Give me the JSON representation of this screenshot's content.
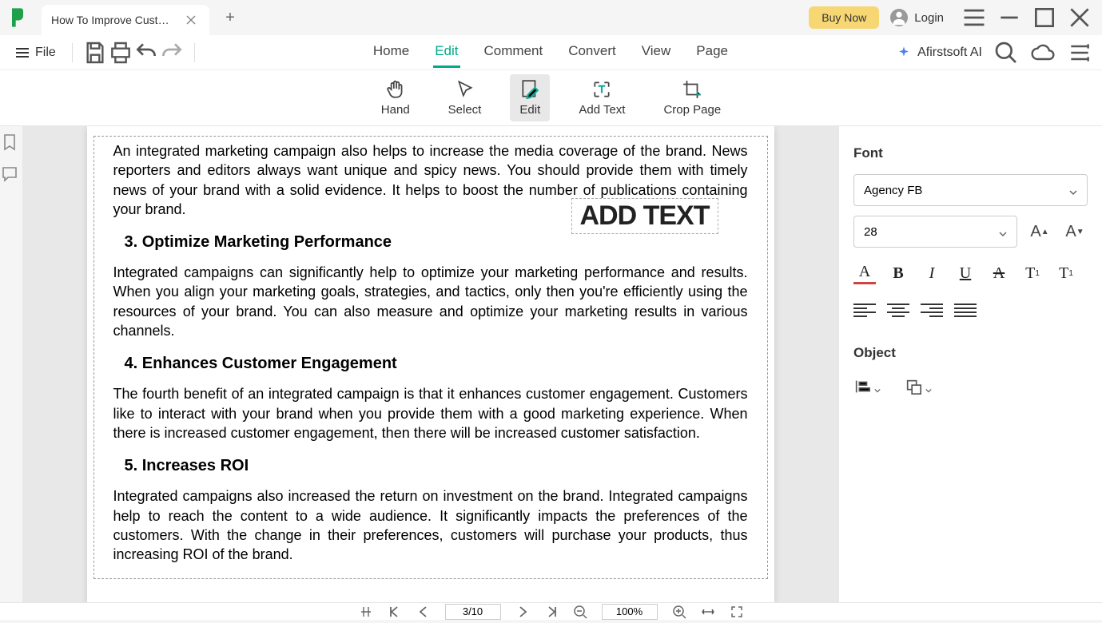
{
  "titlebar": {
    "tab_title": "How To Improve Custo... *",
    "buy_now": "Buy Now",
    "login": "Login"
  },
  "menubar": {
    "file": "File",
    "items": [
      "Home",
      "Edit",
      "Comment",
      "Convert",
      "View",
      "Page"
    ],
    "active_index": 1,
    "ai_label": "Afirstsoft AI"
  },
  "toolbar": {
    "tools": [
      {
        "label": "Hand",
        "icon": "hand"
      },
      {
        "label": "Select",
        "icon": "cursor"
      },
      {
        "label": "Edit",
        "icon": "edit-page",
        "active": true
      },
      {
        "label": "Add Text",
        "icon": "add-text"
      },
      {
        "label": "Crop Page",
        "icon": "crop"
      }
    ]
  },
  "document": {
    "p1": "An integrated marketing campaign also helps to increase the media coverage of the brand. News reporters and editors always want unique and spicy news. You should provide them with timely news of your brand with a solid evidence. It helps to boost the number of publications containing your brand.",
    "h3": "3.  Optimize Marketing Performance",
    "p3": "Integrated campaigns can significantly help to optimize your marketing performance and results. When you align your marketing goals, strategies, and tactics, only then you're efficiently using the resources of your brand. You can also measure and optimize your marketing results in various channels.",
    "h4": "4.  Enhances Customer Engagement",
    "p4": "The fourth benefit of an integrated campaign is that it enhances customer engagement. Customers like to interact with your brand when you provide them with a good marketing experience. When there is increased customer engagement, then there will be increased customer satisfaction.",
    "h5": "5.  Increases ROI",
    "p5": "Integrated campaigns also increased the return on investment on the brand. Integrated campaigns help to reach the content to a wide audience. It significantly impacts the preferences of the customers.  With the change in their preferences, customers will purchase your products, thus increasing ROI of the brand.",
    "add_text_placeholder": "ADD TEXT"
  },
  "right_panel": {
    "font_title": "Font",
    "font_family": "Agency FB",
    "font_size": "28",
    "object_title": "Object"
  },
  "statusbar": {
    "page": "3/10",
    "zoom": "100%"
  }
}
